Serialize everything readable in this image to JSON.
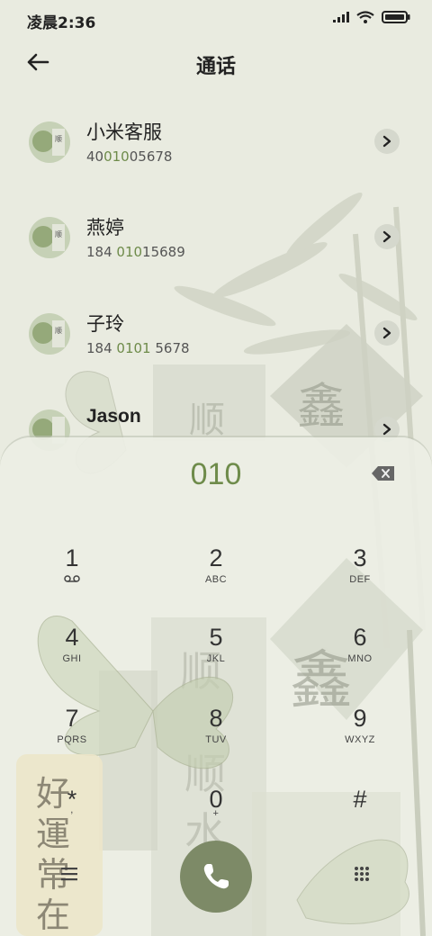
{
  "status_bar": {
    "time": "凌晨2:36"
  },
  "header": {
    "title": "通话"
  },
  "contacts": [
    {
      "name": "小米客服",
      "num_pre": "40",
      "num_hl": "010",
      "num_post": "05678"
    },
    {
      "name": "燕婷",
      "num_pre": "184 ",
      "num_hl": "010",
      "num_post": "15689"
    },
    {
      "name": "子玲",
      "num_pre": "184 ",
      "num_hl": "0101",
      "num_post": " 5678"
    },
    {
      "name": "Jason",
      "num_pre": "",
      "num_hl": "",
      "num_post": ""
    }
  ],
  "dialpad": {
    "number": "010",
    "keys": [
      {
        "digit": "1",
        "sub": ""
      },
      {
        "digit": "2",
        "sub": "ABC"
      },
      {
        "digit": "3",
        "sub": "DEF"
      },
      {
        "digit": "4",
        "sub": "GHI"
      },
      {
        "digit": "5",
        "sub": "JKL"
      },
      {
        "digit": "6",
        "sub": "MNO"
      },
      {
        "digit": "7",
        "sub": "PQRS"
      },
      {
        "digit": "8",
        "sub": "TUV"
      },
      {
        "digit": "9",
        "sub": "WXYZ"
      },
      {
        "digit": "*",
        "sub": ","
      },
      {
        "digit": "0",
        "sub": "+"
      },
      {
        "digit": "#",
        "sub": ""
      }
    ]
  },
  "colors": {
    "accent": "#6e8b4a",
    "call_button": "#7d8a67",
    "background": "#e9ebe0"
  },
  "icons": {
    "back": "arrow-left-icon",
    "arrow": "chevron-right-icon",
    "backspace": "backspace-icon",
    "voicemail": "voicemail-icon",
    "call": "phone-icon",
    "menu": "menu-icon",
    "dialpad": "dialpad-grid-icon"
  }
}
